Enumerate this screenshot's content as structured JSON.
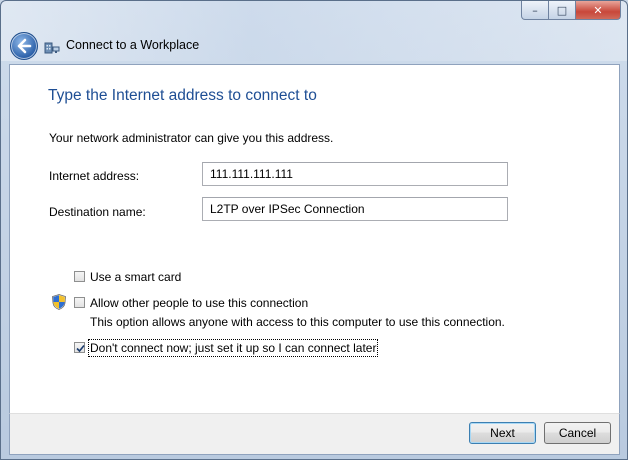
{
  "window": {
    "controls": {
      "minimize": "–",
      "maximize": "□",
      "close": "✕"
    },
    "title": "Connect to a Workplace"
  },
  "page": {
    "heading": "Type the Internet address to connect to",
    "intro": "Your network administrator can give you this address."
  },
  "form": {
    "internet_address_label": "Internet address:",
    "internet_address_value": "111.111.111.111",
    "destination_label": "Destination name:",
    "destination_value": "L2TP over IPSec Connection"
  },
  "options": {
    "smart_card": {
      "label": "Use a smart card",
      "checked": false
    },
    "allow_others": {
      "label": "Allow other people to use this connection",
      "description": "This option allows anyone with access to this computer to use this connection.",
      "checked": false
    },
    "dont_connect": {
      "label": "Don't connect now; just set it up so I can connect later",
      "checked": true
    }
  },
  "buttons": {
    "next": "Next",
    "cancel": "Cancel"
  },
  "icons": {
    "back": "back-arrow-icon",
    "wizard": "network-workplace-icon",
    "shield": "uac-shield-icon"
  }
}
